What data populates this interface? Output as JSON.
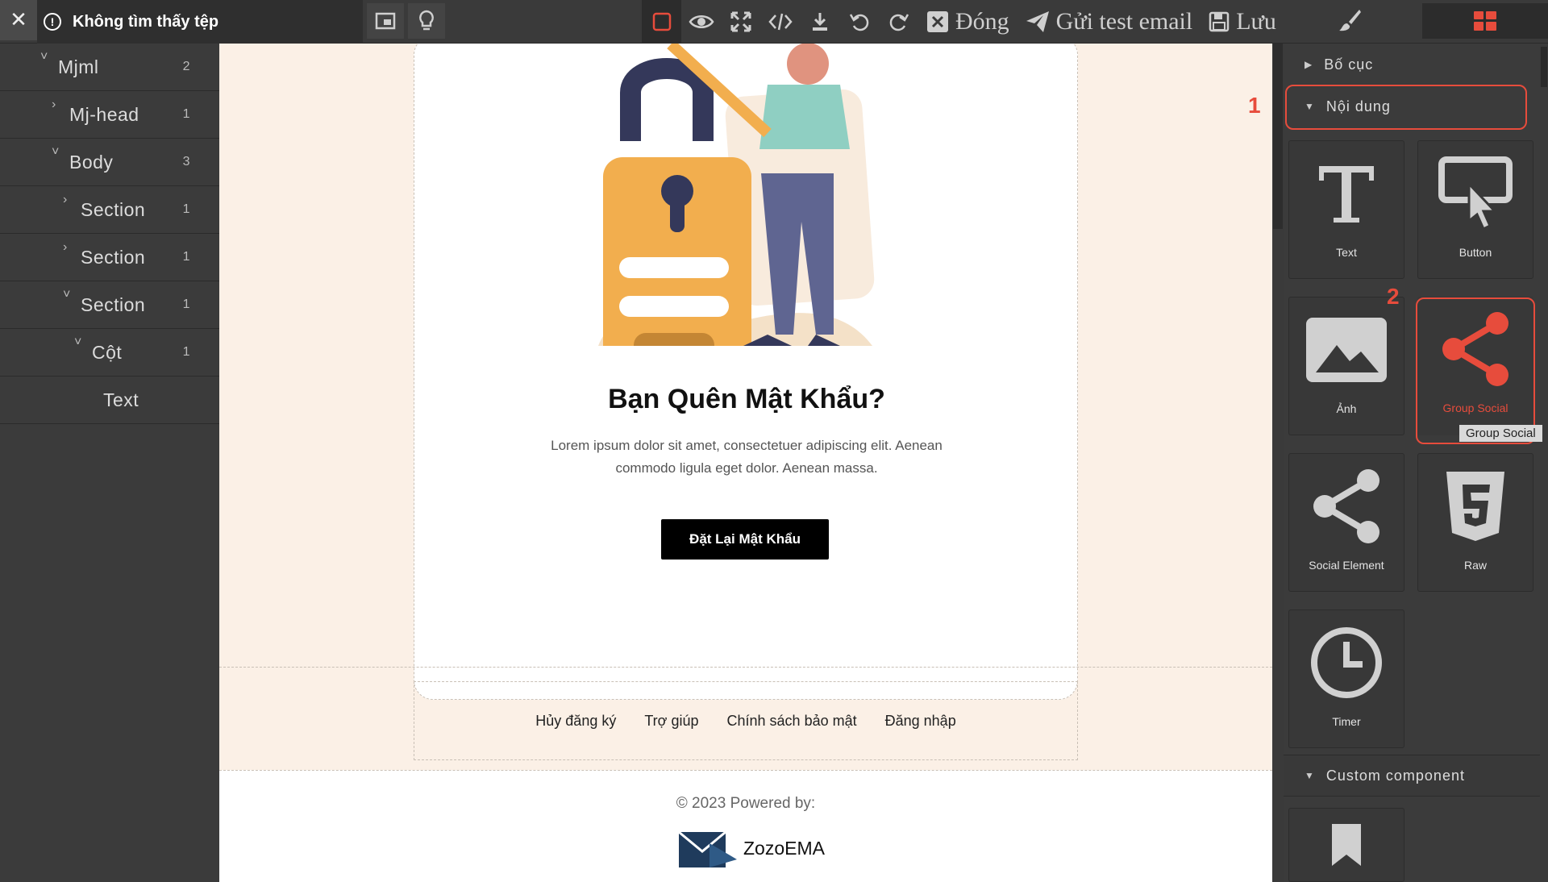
{
  "topbar": {
    "close_glyph": "✕",
    "file_status": "Không tìm thấy tệp",
    "actions": {
      "close": "Đóng",
      "test_email": "Gửi test email",
      "save": "Lưu"
    }
  },
  "layers": [
    {
      "label": "Mjml",
      "count": "2",
      "caret": "˅"
    },
    {
      "label": "Mj-head",
      "count": "1",
      "caret": "›"
    },
    {
      "label": "Body",
      "count": "3",
      "caret": "˅"
    },
    {
      "label": "Section",
      "count": "1",
      "caret": "›"
    },
    {
      "label": "Section",
      "count": "1",
      "caret": "›"
    },
    {
      "label": "Section",
      "count": "1",
      "caret": "˅"
    },
    {
      "label": "Cột",
      "count": "1",
      "caret": "˅"
    },
    {
      "label": "Text",
      "count": "",
      "caret": ""
    }
  ],
  "email": {
    "title": "Bạn Quên Mật Khẩu?",
    "body": "Lorem ipsum dolor sit amet, consectetuer adipiscing elit. Aenean commodo ligula eget dolor. Aenean massa.",
    "cta": "Đặt Lại Mật Khẩu",
    "footer_links": [
      "Hủy đăng ký",
      "Trợ giúp",
      "Chính sách bảo mật",
      "Đăng nhập"
    ],
    "copyright": "© 2023 Powered by:",
    "brand": "ZozoEMA"
  },
  "panel": {
    "categories": {
      "layout": "Bố cục",
      "content": "Nội dung",
      "custom": "Custom component"
    },
    "blocks": {
      "text": "Text",
      "button": "Button",
      "image": "Ảnh",
      "group_social": "Group Social",
      "social_element": "Social Element",
      "raw": "Raw",
      "timer": "Timer"
    },
    "tooltip": "Group Social",
    "annotations": {
      "first": "1",
      "second": "2"
    }
  },
  "colors": {
    "accent": "#e74c3c",
    "canvas_bg": "#fbf0e6",
    "dark": "#3b3b3b",
    "active_box": "#e74c3c"
  }
}
